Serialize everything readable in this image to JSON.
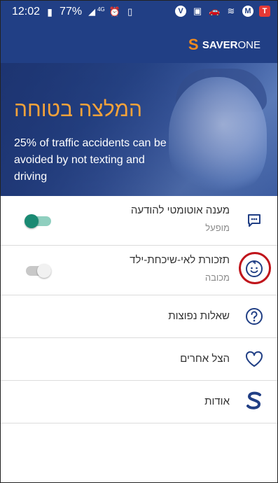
{
  "statusbar": {
    "time": "12:02",
    "battery_percent": "77%",
    "network": "4G"
  },
  "brand": {
    "mark": "S",
    "name_bold": "SAVER",
    "name_light": "ONE",
    "mark_color": "#f28b1e",
    "bar_color": "#213f85"
  },
  "hero": {
    "title": "המלצה בטוחה",
    "subtitle": "25% of traffic accidents can be avoided by not texting and driving",
    "title_color": "#f4a23a"
  },
  "settings": [
    {
      "title": "מענה אוטומטי להודעה",
      "status": "מופעל",
      "icon": "message-dots-icon",
      "toggle": true,
      "toggle_on": true
    },
    {
      "title": "תזכורת לאי-שיכחת-ילד",
      "status": "מכובה",
      "icon": "baby-face-icon",
      "toggle": true,
      "toggle_on": false,
      "highlighted": true
    },
    {
      "title": "שאלות נפוצות",
      "icon": "question-circle-icon"
    },
    {
      "title": "הצל אחרים",
      "icon": "heart-outline-icon"
    },
    {
      "title": "אודות",
      "icon": "saverone-s-icon"
    }
  ],
  "colors": {
    "toggle_on": "#1a8a73",
    "highlight": "#c0141b",
    "icon": "#213f85"
  }
}
